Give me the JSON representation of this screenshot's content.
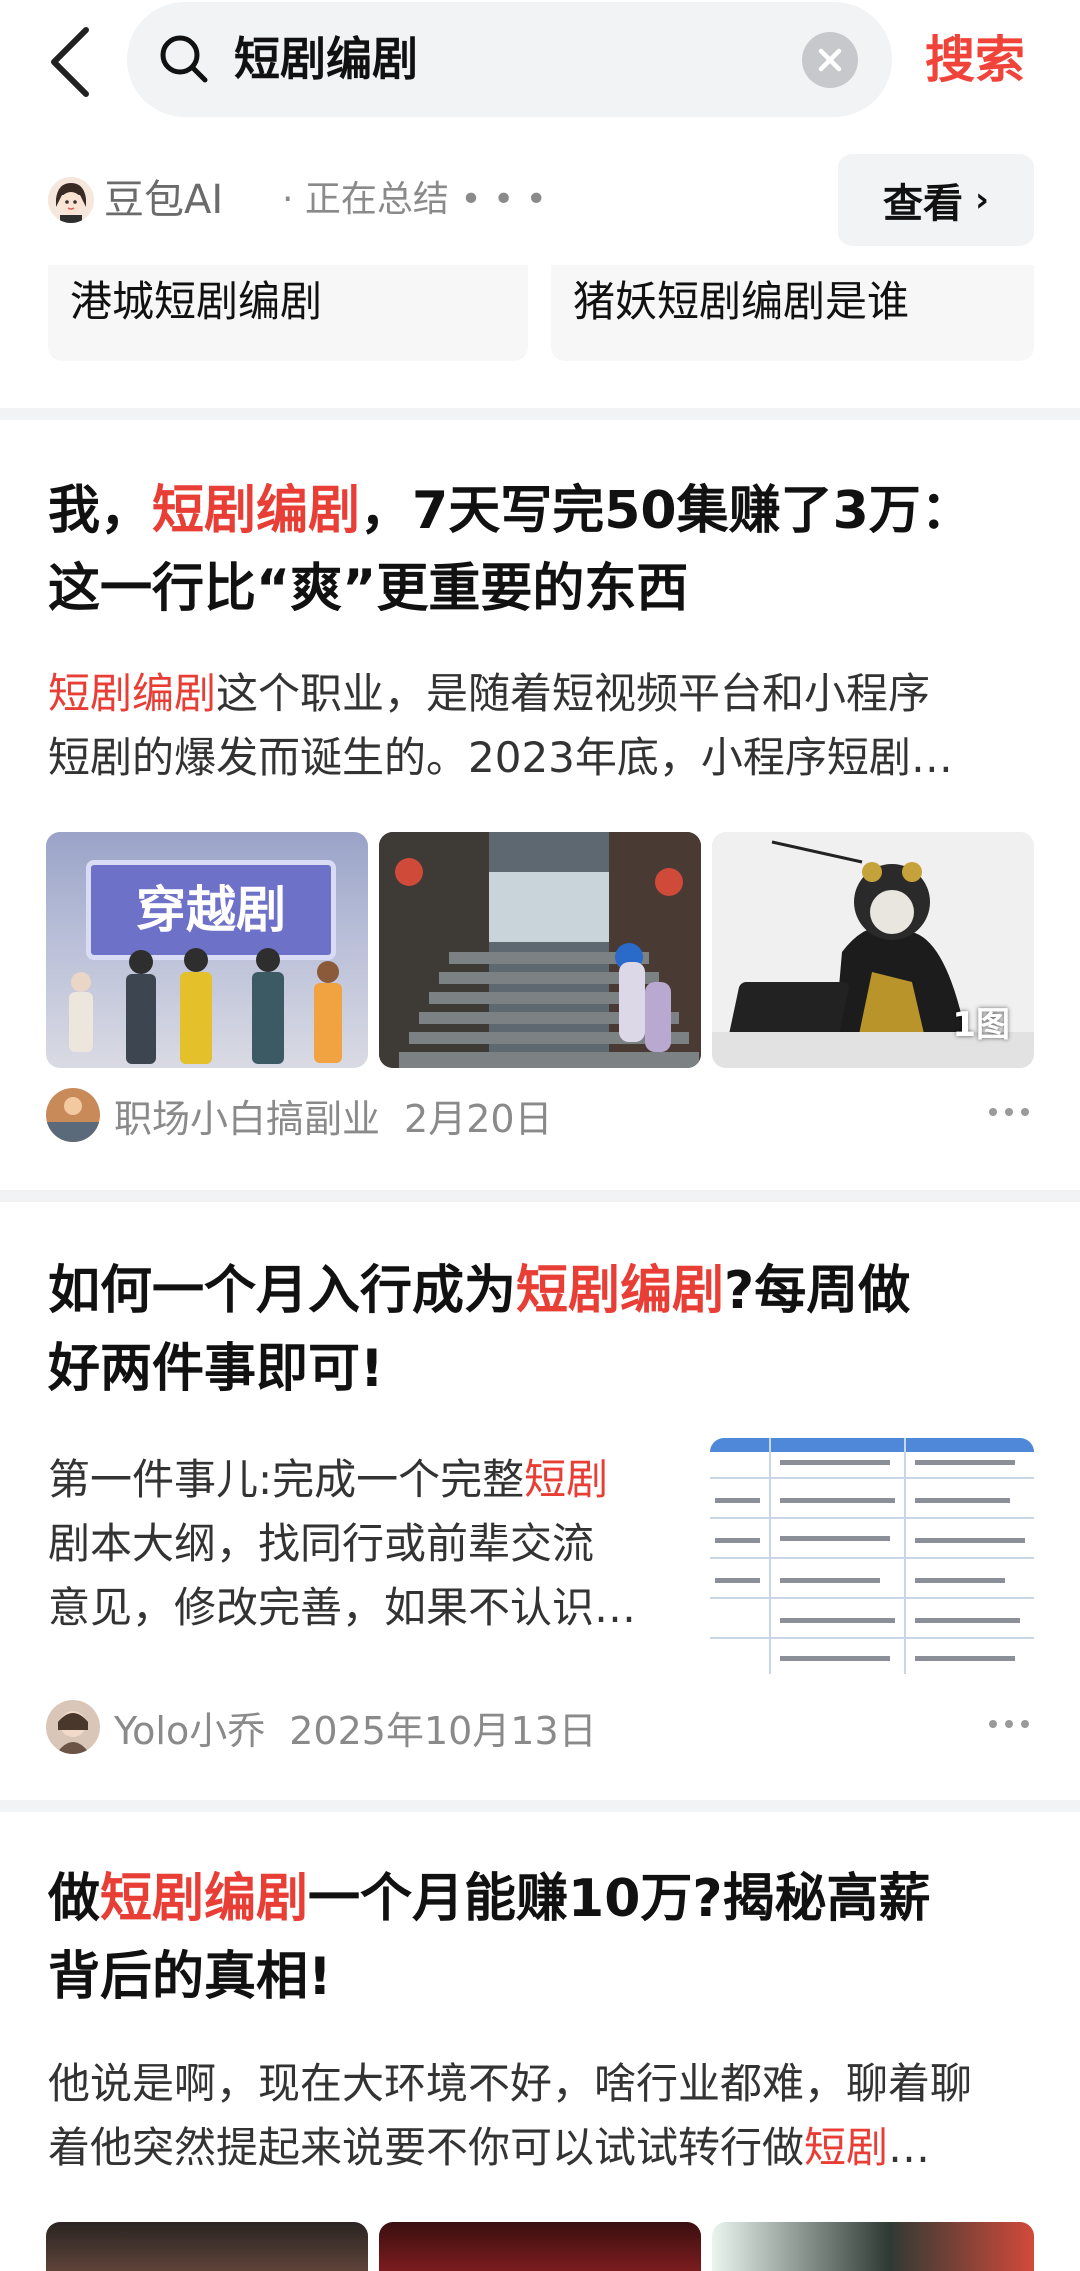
{
  "search": {
    "query": "短剧编剧",
    "button": "搜索"
  },
  "ai": {
    "name": "豆包AI",
    "status": "· 正在总结 • • •",
    "view_label": "查看"
  },
  "related": [
    "港城短剧编剧",
    "猪妖短剧编剧是谁"
  ],
  "articles": [
    {
      "title_pre": "我，",
      "title_hl": "短剧编剧",
      "title_post": "，7天写完50集赚了3万：",
      "title_line2": "这一行比“爽”更重要的东西",
      "snippet_hl": "短剧编剧",
      "snippet_line1": "这个职业，是随着短视频平台和小程序",
      "snippet_line2": "短剧的爆发而诞生的。2023年底，小程序短剧…",
      "image1_text": "穿越剧",
      "image3_badge": "1图",
      "author": "职场小白搞副业",
      "date": "2月20日"
    },
    {
      "title_pre": "如何一个月入行成为",
      "title_hl": "短剧编剧",
      "title_post": "?每周做",
      "title_line2": "好两件事即可!",
      "snippet_pre": "第一件事儿:完成一个完整",
      "snippet_hl": "短剧",
      "snippet_line2": "剧本大纲，找同行或前辈交流",
      "snippet_line3": "意见，修改完善，如果不认识…",
      "author": "Yolo小乔",
      "date": "2025年10月13日"
    },
    {
      "title_pre": "做",
      "title_hl": "短剧编剧",
      "title_post": "一个月能赚10万?揭秘高薪",
      "title_line2": "背后的真相!",
      "snippet_line1": "他说是啊，现在大环境不好，啥行业都难，聊着聊",
      "snippet_pre2": "着他突然提起来说要不你可以试试转行做",
      "snippet_hl": "短剧",
      "snippet_ellipsis": "…"
    }
  ],
  "colors": {
    "accent": "#e83e35",
    "bg_gray": "#f2f3f5"
  }
}
